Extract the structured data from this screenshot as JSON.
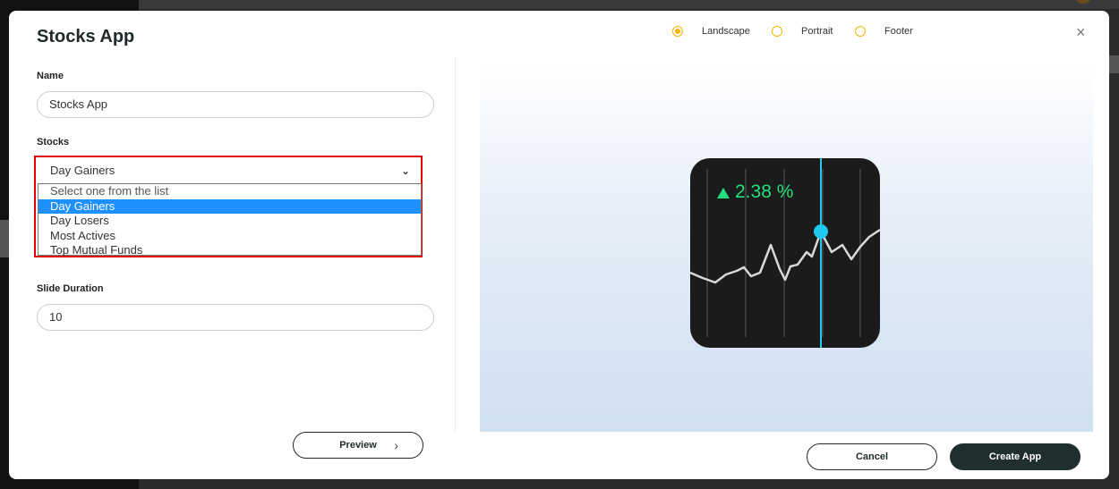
{
  "dialog": {
    "title": "Stocks App",
    "close_symbol": "×"
  },
  "orientation": {
    "options": [
      {
        "label": "Landscape",
        "checked": true
      },
      {
        "label": "Portrait",
        "checked": false
      },
      {
        "label": "Footer",
        "checked": false
      }
    ]
  },
  "form": {
    "name_label": "Name",
    "name_value": "Stocks App",
    "stocks_label": "Stocks",
    "stocks_selected": "Day Gainers",
    "stocks_options": [
      "Select one from the list",
      "Day Gainers",
      "Day Losers",
      "Most Actives",
      "Top Mutual Funds"
    ],
    "slide_duration_label": "Slide Duration",
    "slide_duration_value": "10"
  },
  "preview": {
    "change_text": "2.38 %",
    "up_color": "#22e07a",
    "marker_color": "#1ec8f0"
  },
  "buttons": {
    "preview_label": "Preview",
    "cancel_label": "Cancel",
    "create_label": "Create App"
  },
  "colors": {
    "accent": "#f5b400",
    "highlight": "#e00000",
    "primary_dark": "#1f2f2f"
  }
}
